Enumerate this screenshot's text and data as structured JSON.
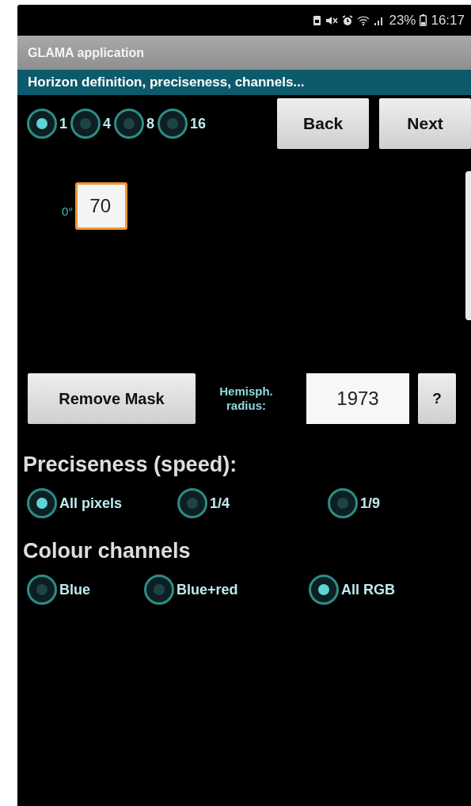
{
  "status_bar": {
    "battery": "23%",
    "time": "16:17"
  },
  "window": {
    "title": "GLAMA application"
  },
  "subtitle": "Horizon definition, preciseness, channels...",
  "steps": [
    {
      "label": "1",
      "selected": true
    },
    {
      "label": "4",
      "selected": false
    },
    {
      "label": "8",
      "selected": false
    },
    {
      "label": "16",
      "selected": false
    }
  ],
  "nav_buttons": [
    "Back",
    "Next"
  ],
  "angle_fields": [
    {
      "label": "0°",
      "value": "70"
    }
  ],
  "mask_button": "Remove Mask",
  "radius": {
    "label_lines": [
      "Hemisph.",
      "radius:"
    ],
    "value": "1973",
    "help": "?"
  },
  "preciseness": {
    "title": "Preciseness (speed):",
    "options": [
      {
        "label": "All pixels",
        "selected": true
      },
      {
        "label": "1/4",
        "selected": false
      },
      {
        "label": "1/9",
        "selected": false
      }
    ]
  },
  "channels": {
    "title": "Colour channels",
    "options": [
      {
        "label": "Blue",
        "selected": false
      },
      {
        "label": "Blue+red",
        "selected": false
      },
      {
        "label": "All RGB",
        "selected": true
      }
    ]
  }
}
